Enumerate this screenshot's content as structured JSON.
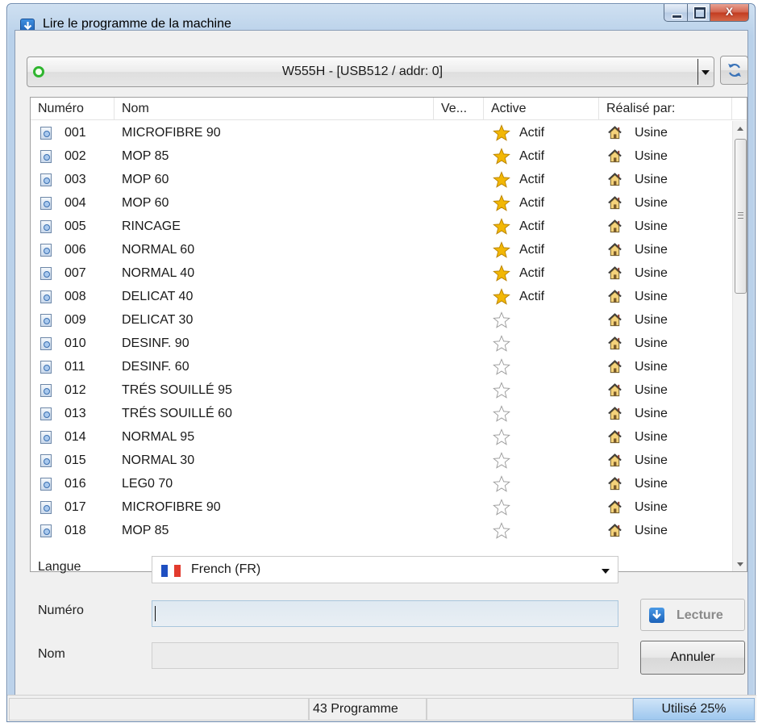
{
  "window": {
    "title": "Lire le programme de la machine",
    "close_label": "X"
  },
  "machine": {
    "label": "W555H - [USB512 / addr: 0]",
    "status_color": "#2fb52f"
  },
  "list": {
    "columns": [
      "Numéro",
      "Nom",
      "Ve...",
      "Active",
      "Réalisé par:"
    ],
    "rows": [
      {
        "num": "001",
        "name": "MICROFIBRE 90",
        "ver": "",
        "active": "Actif",
        "by": "Usine"
      },
      {
        "num": "002",
        "name": "MOP 85",
        "ver": "",
        "active": "Actif",
        "by": "Usine"
      },
      {
        "num": "003",
        "name": "MOP 60",
        "ver": "",
        "active": "Actif",
        "by": "Usine"
      },
      {
        "num": "004",
        "name": "MOP 60",
        "ver": "",
        "active": "Actif",
        "by": "Usine"
      },
      {
        "num": "005",
        "name": "RINCAGE",
        "ver": "",
        "active": "Actif",
        "by": "Usine"
      },
      {
        "num": "006",
        "name": "NORMAL 60",
        "ver": "",
        "active": "Actif",
        "by": "Usine"
      },
      {
        "num": "007",
        "name": "NORMAL 40",
        "ver": "",
        "active": "Actif",
        "by": "Usine"
      },
      {
        "num": "008",
        "name": "DELICAT 40",
        "ver": "",
        "active": "Actif",
        "by": "Usine"
      },
      {
        "num": "009",
        "name": "DELICAT 30",
        "ver": "",
        "active": "",
        "by": "Usine"
      },
      {
        "num": "010",
        "name": "DESINF. 90",
        "ver": "",
        "active": "",
        "by": "Usine"
      },
      {
        "num": "011",
        "name": "DESINF. 60",
        "ver": "",
        "active": "",
        "by": "Usine"
      },
      {
        "num": "012",
        "name": "TRÉS SOUILLÉ 95",
        "ver": "",
        "active": "",
        "by": "Usine"
      },
      {
        "num": "013",
        "name": "TRÉS SOUILLÉ 60",
        "ver": "",
        "active": "",
        "by": "Usine"
      },
      {
        "num": "014",
        "name": "NORMAL 95",
        "ver": "",
        "active": "",
        "by": "Usine"
      },
      {
        "num": "015",
        "name": "NORMAL 30",
        "ver": "",
        "active": "",
        "by": "Usine"
      },
      {
        "num": "016",
        "name": "LEG0 70",
        "ver": "",
        "active": "",
        "by": "Usine"
      },
      {
        "num": "017",
        "name": "MICROFIBRE 90",
        "ver": "",
        "active": "",
        "by": "Usine"
      },
      {
        "num": "018",
        "name": "MOP 85",
        "ver": "",
        "active": "",
        "by": "Usine"
      }
    ]
  },
  "form": {
    "langue_label": "Langue",
    "langue_value": "French (FR)",
    "numero_label": "Numéro",
    "numero_value": "",
    "nom_label": "Nom",
    "nom_value": "",
    "lecture_button": "Lecture",
    "annuler_button": "Annuler"
  },
  "status": {
    "count": "43 Programme",
    "used": "Utilisé 25%"
  },
  "colors": {
    "star_active": "#f2b705",
    "flag": [
      "#1f4fc1",
      "#ffffff",
      "#e23b2e"
    ]
  }
}
